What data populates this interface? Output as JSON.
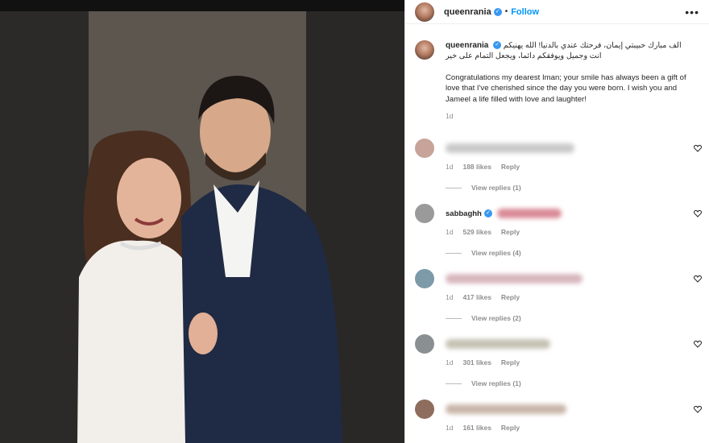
{
  "post": {
    "username": "queenrania",
    "verified_glyph": "✓",
    "separator": "•",
    "follow_label": "Follow",
    "more_label": "•••",
    "caption_arabic": "الف مبارك حبيبتي إيمان، فرحتك عندي بالدنيا! الله يهنيكم انت وجميل ويوفقكم دائما، ويجعل التمام على خير",
    "caption_english": "Congratulations my dearest Iman; your smile has always been a gift of love that I've cherished since the day you were born. I wish you and Jameel a life filled with love and laughter!",
    "time": "1d"
  },
  "comments": [
    {
      "name": "",
      "time": "1d",
      "likes": "188 likes",
      "reply_label": "Reply",
      "view_replies": "View replies (1)",
      "avatar_color": "#c7a39a",
      "blur_color": "#b0b0b0"
    },
    {
      "name": "sabbaghh",
      "time": "1d",
      "likes": "529 likes",
      "reply_label": "Reply",
      "view_replies": "View replies (4)",
      "avatar_color": "#9a9a9a",
      "blur_color": "#c56a7c"
    },
    {
      "name": "",
      "time": "1d",
      "likes": "417 likes",
      "reply_label": "Reply",
      "view_replies": "View replies (2)",
      "avatar_color": "#7d9aa8",
      "blur_color": "#c9a4ad"
    },
    {
      "name": "",
      "time": "1d",
      "likes": "301 likes",
      "reply_label": "Reply",
      "view_replies": "View replies (1)",
      "avatar_color": "#8a8f92",
      "blur_color": "#b7b3a3"
    },
    {
      "name": "",
      "time": "1d",
      "likes": "161 likes",
      "reply_label": "Reply",
      "view_replies": "",
      "avatar_color": "#8f6d5d",
      "blur_color": "#b8a397"
    }
  ],
  "colors": {
    "accent": "#0095f6",
    "verified": "#3897f0",
    "muted": "#8e8e8e"
  },
  "icons": [
    "verified-badge-icon",
    "more-options-icon",
    "heart-icon"
  ]
}
